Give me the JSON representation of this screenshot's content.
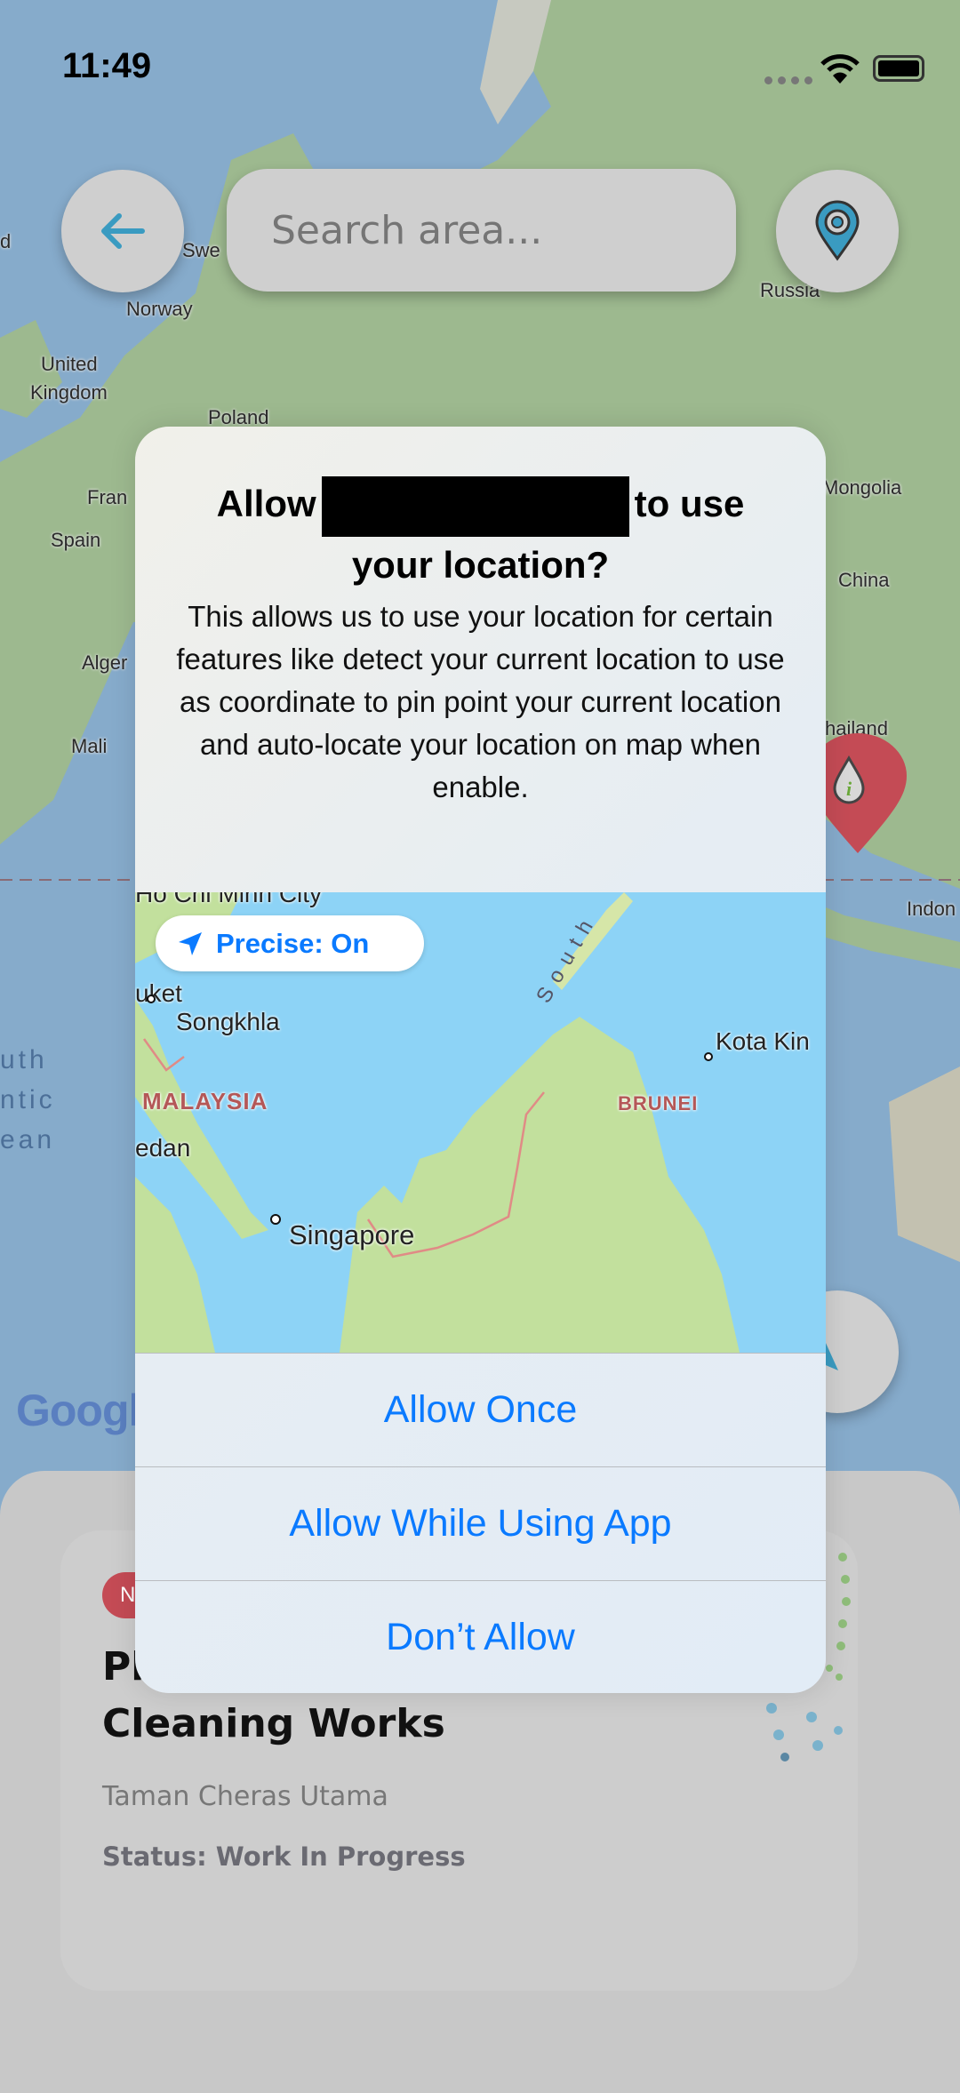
{
  "status_bar": {
    "time": "11:49",
    "icons": [
      "signal-dots-icon",
      "wifi-icon",
      "battery-icon"
    ]
  },
  "header": {
    "back_icon": "arrow-left-icon",
    "search_placeholder": "Search area...",
    "location_icon": "map-pin-target-icon"
  },
  "background_map": {
    "labels": [
      "d",
      "Swe",
      "Norway",
      "United",
      "Kingdom",
      "Poland",
      "Russia",
      "Fran",
      "Spain",
      "Mongolia",
      "China",
      "Alger",
      "Mali",
      "hailand",
      "Indon"
    ],
    "ocean_lines": [
      "uth",
      "ntic",
      "ean"
    ],
    "logo": "Google",
    "marker_icon": "info-drop-marker-icon",
    "navigate_icon": "navigation-arrow-icon",
    "colors": {
      "water": "#86abcb",
      "land": "#9db98f",
      "marker": "#c44b55",
      "accent": "#3a9bc1"
    }
  },
  "dialog": {
    "title_prefix": "Allow",
    "title_suffix": "to use",
    "title_line2": "your location?",
    "body": "This allows us to use your location for certain features like detect your current location to use as coordinate to pin point your current location and auto-locate your location on map when enable.",
    "precise": "Precise: On",
    "map_labels": {
      "hcm": "Ho Chi Minh City",
      "phuket": "uket",
      "songkhla": "Songkhla",
      "malaysia": "MALAYSIA",
      "medan": "edan",
      "singapore": "Singapore",
      "kota": "Kota Kin",
      "brunei": "BRUNEI",
      "south": "South"
    },
    "buttons": [
      "Allow Once",
      "Allow While Using App",
      "Don’t Allow"
    ],
    "button_color": "#0a7aff"
  },
  "card": {
    "badge": "N",
    "title_line1": "Pl",
    "title_line2": "Cleaning Works",
    "location": "Taman Cheras Utama",
    "status": "Status: Work In Progress",
    "badge_color": "#c44b55"
  }
}
